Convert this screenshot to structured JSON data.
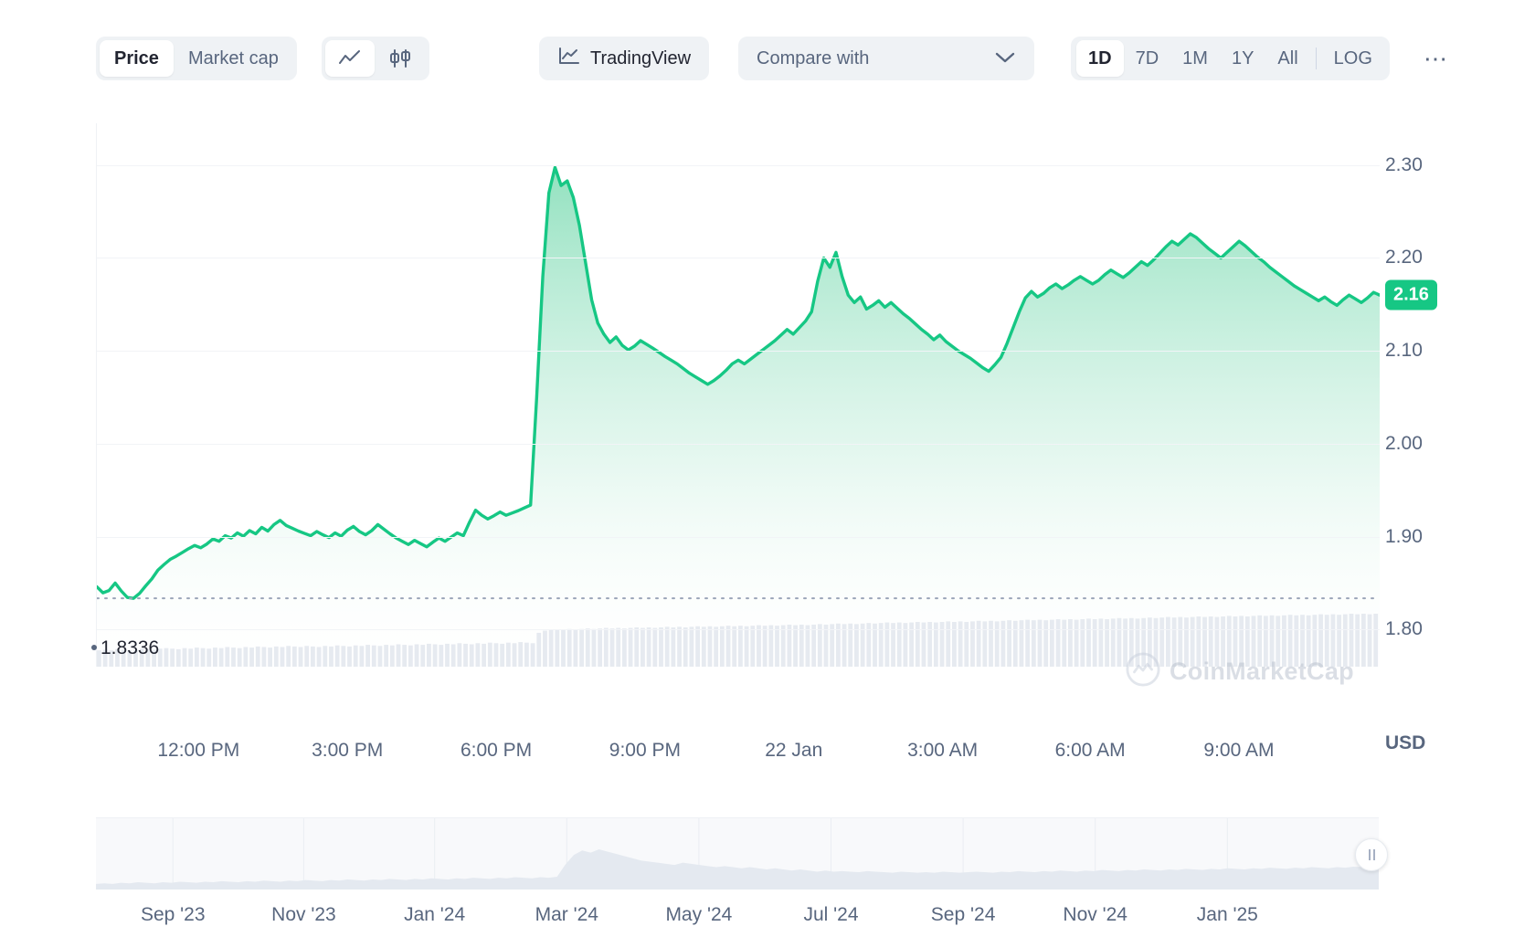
{
  "toolbar": {
    "metric_options": [
      {
        "label": "Price",
        "active": true
      },
      {
        "label": "Market cap",
        "active": false
      }
    ],
    "chart_type_options": [
      {
        "icon": "line-chart-icon",
        "active": true
      },
      {
        "icon": "candlestick-chart-icon",
        "active": false
      }
    ],
    "tradingview_label": "TradingView",
    "tradingview_icon": "tradingview-icon",
    "compare_label": "Compare with",
    "compare_chevron_icon": "chevron-down-icon",
    "range_options": [
      {
        "label": "1D",
        "active": true
      },
      {
        "label": "7D",
        "active": false
      },
      {
        "label": "1M",
        "active": false
      },
      {
        "label": "1Y",
        "active": false
      },
      {
        "label": "All",
        "active": false
      }
    ],
    "log_label": "LOG",
    "more_label": "⋯",
    "more_icon": "ellipsis-icon"
  },
  "chart_data": {
    "type": "area",
    "title": "",
    "xlabel": "",
    "ylabel": "USD",
    "currency_label": "USD",
    "ylim": [
      1.76,
      2.345
    ],
    "y_ticks": [
      "2.30",
      "2.20",
      "2.10",
      "2.00",
      "1.90",
      "1.80"
    ],
    "y_tick_values": [
      2.3,
      2.2,
      2.1,
      2.0,
      1.9,
      1.8
    ],
    "current_price_label": "2.16",
    "current_price_value": 2.16,
    "low_marker_label": "1.8336",
    "low_marker_value": 1.8336,
    "line_color": "#16c784",
    "fill_color_top": "#a0e6c8",
    "fill_color_bottom": "#ffffff",
    "x_ticks": [
      "12:00 PM",
      "3:00 PM",
      "6:00 PM",
      "9:00 PM",
      "22 Jan",
      "3:00 AM",
      "6:00 AM",
      "9:00 AM"
    ],
    "x_tick_positions_pct": [
      8.0,
      19.6,
      31.2,
      42.8,
      54.4,
      66.0,
      77.5,
      89.1
    ],
    "grid": true,
    "legend": "none",
    "watermark_text": "CoinMarketCap",
    "watermark_icon": "coinmarketcap-logo-icon",
    "values": [
      1.846,
      1.8395,
      1.842,
      1.85,
      1.8415,
      1.8345,
      1.8336,
      1.839,
      1.847,
      1.8545,
      1.864,
      1.87,
      1.8755,
      1.879,
      1.883,
      1.887,
      1.8905,
      1.888,
      1.892,
      1.8975,
      1.895,
      1.901,
      1.8985,
      1.904,
      1.9005,
      1.9065,
      1.903,
      1.91,
      1.906,
      1.913,
      1.9175,
      1.912,
      1.909,
      1.906,
      1.9035,
      1.901,
      1.9055,
      1.902,
      1.899,
      1.904,
      1.9005,
      1.907,
      1.911,
      1.9055,
      1.902,
      1.9065,
      1.913,
      1.908,
      1.903,
      1.8985,
      1.895,
      1.8915,
      1.896,
      1.8925,
      1.889,
      1.894,
      1.8985,
      1.895,
      1.8995,
      1.904,
      1.901,
      1.9155,
      1.9285,
      1.923,
      1.919,
      1.9225,
      1.9265,
      1.923,
      1.9255,
      1.928,
      1.931,
      1.934,
      2.05,
      2.18,
      2.27,
      2.2975,
      2.278,
      2.283,
      2.265,
      2.235,
      2.195,
      2.155,
      2.13,
      2.118,
      2.109,
      2.115,
      2.106,
      2.101,
      2.105,
      2.111,
      2.107,
      2.103,
      2.0985,
      2.094,
      2.09,
      2.086,
      2.081,
      2.076,
      2.072,
      2.068,
      2.064,
      2.068,
      2.073,
      2.079,
      2.086,
      2.09,
      2.086,
      2.091,
      2.096,
      2.101,
      2.106,
      2.111,
      2.117,
      2.123,
      2.118,
      2.125,
      2.132,
      2.142,
      2.175,
      2.2,
      2.19,
      2.206,
      2.18,
      2.16,
      2.152,
      2.158,
      2.145,
      2.149,
      2.154,
      2.147,
      2.152,
      2.146,
      2.14,
      2.135,
      2.129,
      2.123,
      2.118,
      2.112,
      2.117,
      2.11,
      2.105,
      2.1,
      2.096,
      2.092,
      2.087,
      2.082,
      2.078,
      2.085,
      2.093,
      2.108,
      2.125,
      2.142,
      2.157,
      2.164,
      2.158,
      2.162,
      2.168,
      2.172,
      2.167,
      2.171,
      2.176,
      2.18,
      2.176,
      2.172,
      2.176,
      2.182,
      2.187,
      2.183,
      2.179,
      2.184,
      2.19,
      2.196,
      2.192,
      2.198,
      2.205,
      2.212,
      2.218,
      2.214,
      2.22,
      2.226,
      2.222,
      2.216,
      2.21,
      2.205,
      2.2,
      2.206,
      2.212,
      2.218,
      2.213,
      2.207,
      2.201,
      2.196,
      2.19,
      2.185,
      2.18,
      2.175,
      2.17,
      2.166,
      2.162,
      2.158,
      2.154,
      2.158,
      2.153,
      2.149,
      2.155,
      2.16,
      2.156,
      2.152,
      2.157,
      2.163,
      2.16
    ],
    "volume_series_note": "volume bars below price series",
    "volume_values": [
      0.3,
      0.31,
      0.3,
      0.32,
      0.31,
      0.3,
      0.31,
      0.33,
      0.32,
      0.31,
      0.33,
      0.34,
      0.33,
      0.32,
      0.34,
      0.33,
      0.35,
      0.34,
      0.33,
      0.35,
      0.34,
      0.36,
      0.35,
      0.34,
      0.36,
      0.35,
      0.37,
      0.36,
      0.35,
      0.37,
      0.36,
      0.38,
      0.37,
      0.36,
      0.38,
      0.37,
      0.36,
      0.38,
      0.37,
      0.39,
      0.38,
      0.37,
      0.39,
      0.38,
      0.4,
      0.39,
      0.38,
      0.4,
      0.39,
      0.41,
      0.4,
      0.39,
      0.41,
      0.4,
      0.42,
      0.41,
      0.4,
      0.42,
      0.41,
      0.43,
      0.42,
      0.41,
      0.43,
      0.42,
      0.44,
      0.43,
      0.42,
      0.44,
      0.43,
      0.45,
      0.44,
      0.43,
      0.62,
      0.66,
      0.68,
      0.67,
      0.68,
      0.69,
      0.68,
      0.69,
      0.7,
      0.69,
      0.7,
      0.71,
      0.7,
      0.71,
      0.7,
      0.71,
      0.72,
      0.71,
      0.72,
      0.71,
      0.72,
      0.73,
      0.72,
      0.73,
      0.72,
      0.73,
      0.74,
      0.73,
      0.74,
      0.73,
      0.74,
      0.75,
      0.74,
      0.75,
      0.74,
      0.75,
      0.76,
      0.75,
      0.76,
      0.75,
      0.76,
      0.77,
      0.76,
      0.77,
      0.76,
      0.77,
      0.78,
      0.77,
      0.78,
      0.79,
      0.78,
      0.79,
      0.78,
      0.79,
      0.8,
      0.79,
      0.8,
      0.81,
      0.8,
      0.81,
      0.8,
      0.81,
      0.82,
      0.81,
      0.82,
      0.81,
      0.82,
      0.83,
      0.82,
      0.83,
      0.82,
      0.83,
      0.84,
      0.83,
      0.84,
      0.83,
      0.84,
      0.85,
      0.84,
      0.85,
      0.86,
      0.85,
      0.86,
      0.85,
      0.86,
      0.87,
      0.86,
      0.87,
      0.86,
      0.87,
      0.88,
      0.87,
      0.88,
      0.87,
      0.88,
      0.89,
      0.88,
      0.89,
      0.88,
      0.89,
      0.9,
      0.89,
      0.9,
      0.91,
      0.9,
      0.91,
      0.9,
      0.91,
      0.92,
      0.91,
      0.92,
      0.91,
      0.92,
      0.93,
      0.92,
      0.93,
      0.92,
      0.93,
      0.94,
      0.93,
      0.94,
      0.93,
      0.94,
      0.95,
      0.94,
      0.95,
      0.94,
      0.95,
      0.96,
      0.95,
      0.96,
      0.95,
      0.96,
      0.97,
      0.96,
      0.97,
      0.96,
      0.97
    ]
  },
  "navigator": {
    "x_ticks": [
      "Sep '23",
      "Nov '23",
      "Jan '24",
      "Mar '24",
      "May '24",
      "Jul '24",
      "Sep '24",
      "Nov '24",
      "Jan '25"
    ],
    "x_tick_positions_pct": [
      6.0,
      16.2,
      26.4,
      36.7,
      47.0,
      57.3,
      67.6,
      77.9,
      88.2
    ],
    "handle_icon": "drag-handle-icon",
    "series_values": [
      0.1,
      0.11,
      0.1,
      0.12,
      0.11,
      0.13,
      0.12,
      0.11,
      0.13,
      0.12,
      0.14,
      0.13,
      0.12,
      0.14,
      0.13,
      0.15,
      0.14,
      0.13,
      0.15,
      0.14,
      0.16,
      0.15,
      0.14,
      0.16,
      0.15,
      0.17,
      0.16,
      0.15,
      0.17,
      0.16,
      0.18,
      0.17,
      0.16,
      0.18,
      0.17,
      0.19,
      0.18,
      0.17,
      0.19,
      0.18,
      0.2,
      0.19,
      0.18,
      0.2,
      0.19,
      0.21,
      0.2,
      0.19,
      0.21,
      0.2,
      0.22,
      0.21,
      0.2,
      0.22,
      0.21,
      0.23,
      0.45,
      0.62,
      0.7,
      0.66,
      0.72,
      0.68,
      0.64,
      0.6,
      0.56,
      0.52,
      0.5,
      0.48,
      0.46,
      0.44,
      0.48,
      0.46,
      0.44,
      0.42,
      0.4,
      0.42,
      0.4,
      0.38,
      0.4,
      0.38,
      0.36,
      0.38,
      0.36,
      0.34,
      0.36,
      0.34,
      0.32,
      0.34,
      0.32,
      0.33,
      0.32,
      0.31,
      0.33,
      0.32,
      0.31,
      0.3,
      0.32,
      0.31,
      0.3,
      0.31,
      0.3,
      0.32,
      0.31,
      0.3,
      0.31,
      0.32,
      0.31,
      0.3,
      0.32,
      0.31,
      0.33,
      0.32,
      0.31,
      0.33,
      0.32,
      0.34,
      0.33,
      0.32,
      0.34,
      0.33,
      0.35,
      0.34,
      0.33,
      0.35,
      0.34,
      0.36,
      0.35,
      0.34,
      0.36,
      0.35,
      0.37,
      0.36,
      0.35,
      0.37,
      0.36,
      0.38,
      0.37,
      0.36,
      0.38,
      0.37,
      0.39,
      0.38,
      0.37,
      0.39,
      0.38,
      0.4,
      0.39,
      0.38,
      0.4,
      0.39,
      0.41,
      0.4,
      0.39,
      0.41
    ]
  }
}
